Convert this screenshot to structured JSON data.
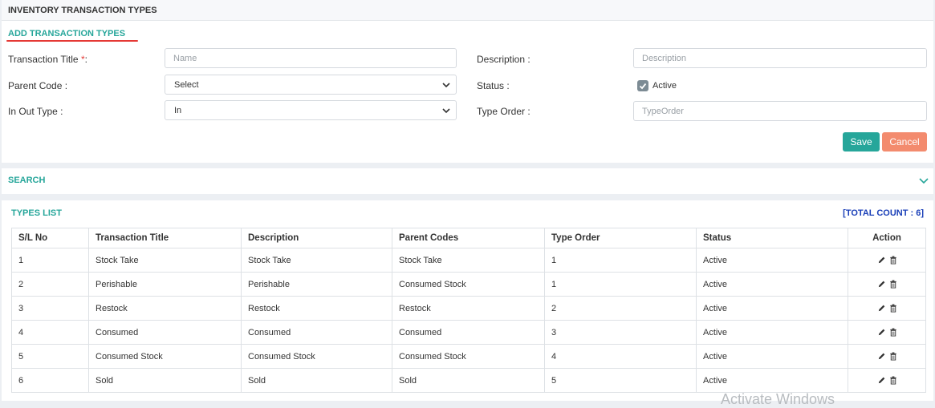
{
  "header": {
    "title": "INVENTORY TRANSACTION TYPES"
  },
  "form": {
    "section_title": "ADD TRANSACTION TYPES",
    "transaction_title": {
      "label": "Transaction Title ",
      "required_mark": "*",
      "label_suffix": ":",
      "placeholder": "Name",
      "value": ""
    },
    "description": {
      "label": "Description :",
      "placeholder": "Description",
      "value": ""
    },
    "parent_code": {
      "label": "Parent Code :",
      "selected": "Select"
    },
    "status": {
      "label": "Status :",
      "checkbox_label": "Active",
      "checked": true
    },
    "in_out_type": {
      "label": "In Out Type :",
      "selected": "In"
    },
    "type_order": {
      "label": "Type Order :",
      "placeholder": "TypeOrder",
      "value": ""
    },
    "save_label": "Save",
    "cancel_label": "Cancel"
  },
  "search": {
    "title": "SEARCH"
  },
  "types_list": {
    "title": "TYPES LIST",
    "total_count": "[TOTAL COUNT : 6]",
    "columns": [
      "S/L No",
      "Transaction Title",
      "Description",
      "Parent Codes",
      "Type Order",
      "Status",
      "Action"
    ],
    "rows": [
      [
        "1",
        "Stock Take",
        "Stock Take",
        "Stock Take",
        "1",
        "Active"
      ],
      [
        "2",
        "Perishable",
        "Perishable",
        "Consumed Stock",
        "1",
        "Active"
      ],
      [
        "3",
        "Restock",
        "Restock",
        "Restock",
        "2",
        "Active"
      ],
      [
        "4",
        "Consumed",
        "Consumed",
        "Consumed",
        "3",
        "Active"
      ],
      [
        "5",
        "Consumed Stock",
        "Consumed Stock",
        "Consumed Stock",
        "4",
        "Active"
      ],
      [
        "6",
        "Sold",
        "Sold",
        "Sold",
        "5",
        "Active"
      ]
    ]
  },
  "watermark": "Activate Windows",
  "colors": {
    "accent": "#26a69a",
    "danger_underline": "#e53935",
    "cancel": "#f38b6e",
    "count": "#1a3fb8"
  }
}
